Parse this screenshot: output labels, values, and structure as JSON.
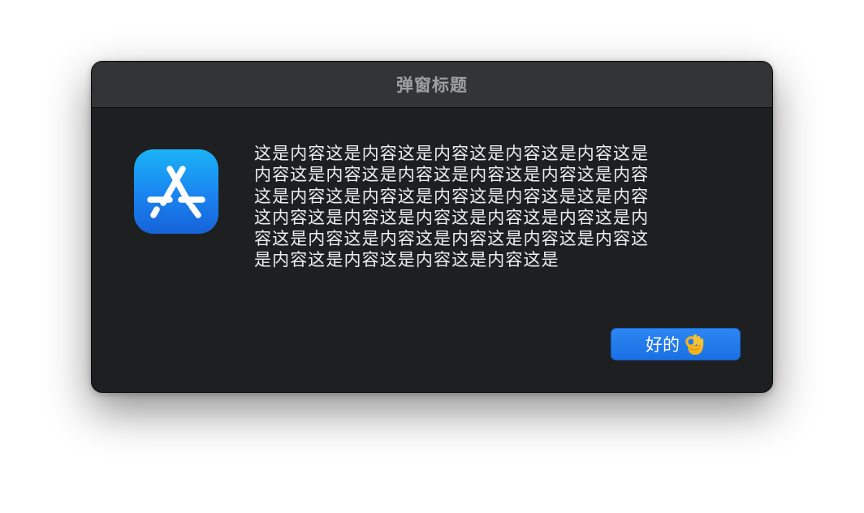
{
  "dialog": {
    "title": "弹窗标题",
    "message": "这是内容这是内容这是内容这是内容这是内容这是\n内容这是内容这是内容这是内容这是内容这是内容\n这是内容这是内容这是内容这是内容这是这是内容\n这内容这是内容这是内容这是内容这是内容这是内\n容这是内容这是内容这是内容这是内容这是内容这\n是内容这是内容这是内容这是内容这是",
    "app_icon": "app-store-icon",
    "ok_button": {
      "label": "好的",
      "emoji_icon": "ok-hand-icon"
    }
  },
  "colors": {
    "dialog_background": "#1e1f21",
    "titlebar_background": "#323436",
    "title_text": "#9ea0a3",
    "message_text": "#eeeeee",
    "button_background": "#1f75e8",
    "icon_gradient_top": "#1ab3f6",
    "icon_gradient_bottom": "#1663d8"
  }
}
